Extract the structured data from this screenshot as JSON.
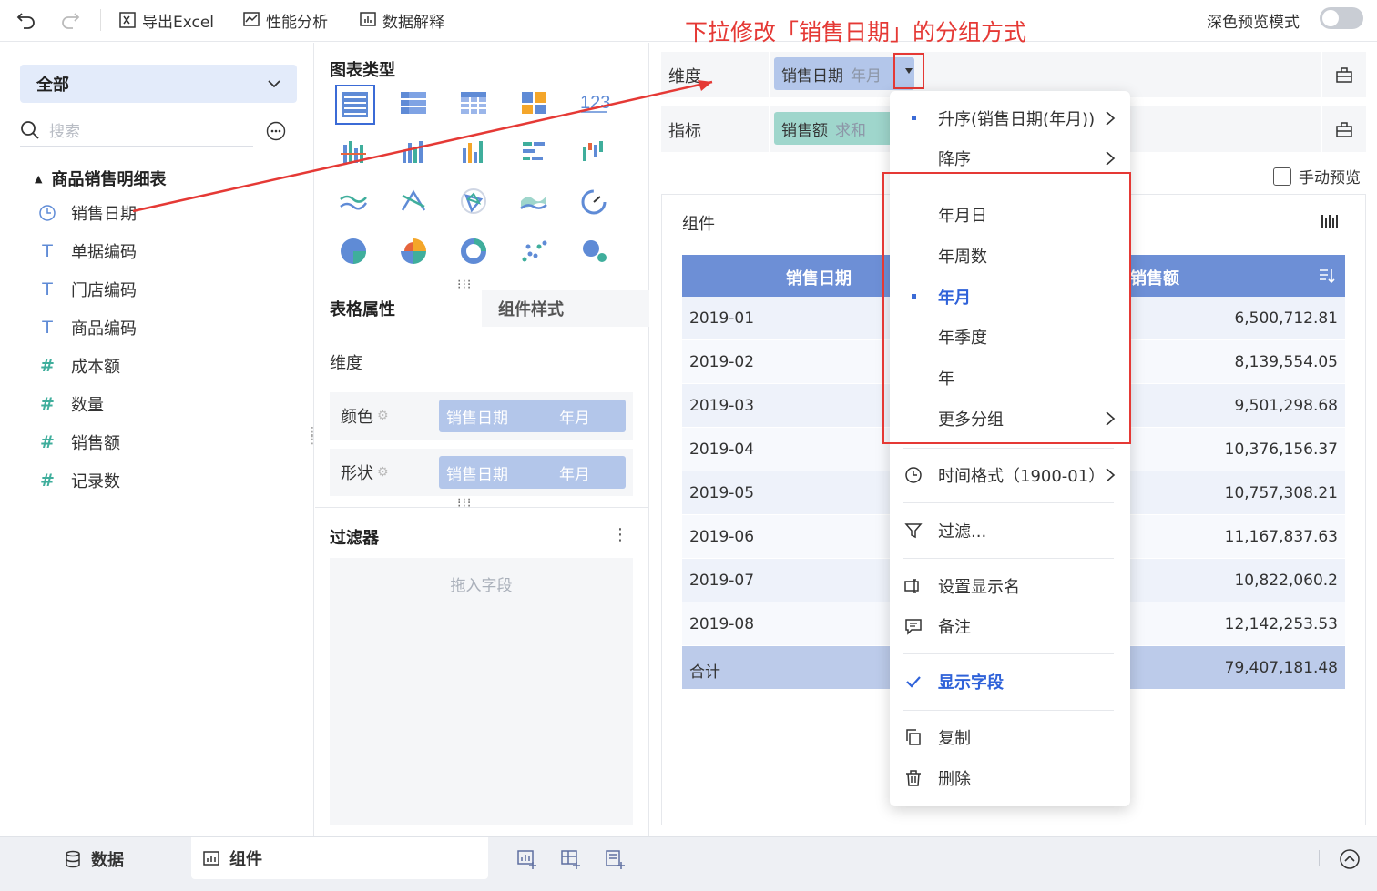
{
  "toolbar": {
    "undo_icon": "undo-icon",
    "redo_icon": "redo-icon",
    "export_label": "导出Excel",
    "perf_label": "性能分析",
    "explain_label": "数据解释",
    "dark_preview_label": "深色预览模式",
    "dark_preview_on": false
  },
  "annotation": "下拉修改「销售日期」的分组方式",
  "left": {
    "scope": "全部",
    "search_placeholder": "搜索",
    "table_name": "商品销售明细表",
    "fields": [
      {
        "icon": "clock-icon",
        "label": "销售日期"
      },
      {
        "icon": "text-icon",
        "label": "单据编码"
      },
      {
        "icon": "text-icon",
        "label": "门店编码"
      },
      {
        "icon": "text-icon",
        "label": "商品编码"
      },
      {
        "icon": "number-icon",
        "label": "成本额"
      },
      {
        "icon": "number-icon",
        "label": "数量"
      },
      {
        "icon": "number-icon",
        "label": "销售额"
      },
      {
        "icon": "number-icon",
        "label": "记录数"
      }
    ]
  },
  "middle": {
    "chart_type_title": "图表类型",
    "tab_table_props": "表格属性",
    "tab_component_style": "组件样式",
    "dimension_label": "维度",
    "color_label": "颜色",
    "color_field": "销售日期",
    "color_group": "年月",
    "shape_label": "形状",
    "shape_field": "销售日期",
    "shape_group": "年月",
    "filter_title": "过滤器",
    "filter_hint": "拖入字段"
  },
  "right": {
    "dimension_label": "维度",
    "dimension_pill": "销售日期",
    "dimension_pill_sub": "年月",
    "measure_label": "指标",
    "measure_pill": "销售额",
    "measure_pill_sub": "求和",
    "manual_preview": "手动预览",
    "component_title": "组件",
    "table": {
      "headers": [
        "销售日期",
        "销售额"
      ],
      "rows": [
        [
          "2019-01",
          "6,500,712.81"
        ],
        [
          "2019-02",
          "8,139,554.05"
        ],
        [
          "2019-03",
          "9,501,298.68"
        ],
        [
          "2019-04",
          "10,376,156.37"
        ],
        [
          "2019-05",
          "10,757,308.21"
        ],
        [
          "2019-06",
          "11,167,837.63"
        ],
        [
          "2019-07",
          "10,822,060.2"
        ],
        [
          "2019-08",
          "12,142,253.53"
        ]
      ],
      "total_label": "合计",
      "total_value": "79,407,181.48"
    }
  },
  "menu": {
    "sort_asc": "升序(销售日期(年月))",
    "sort_desc": "降序",
    "group_ymd": "年月日",
    "group_yw": "年周数",
    "group_ym": "年月",
    "group_yq": "年季度",
    "group_y": "年",
    "more_group": "更多分组",
    "time_format": "时间格式（1900-01）",
    "filter": "过滤...",
    "display_name": "设置显示名",
    "note": "备注",
    "show_field": "显示字段",
    "copy": "复制",
    "delete": "删除"
  },
  "bottom": {
    "data_tab": "数据",
    "component_tab": "组件"
  },
  "colors": {
    "accent": "#2f62d9",
    "highlight_red": "#e53935",
    "table_header": "#6d8fd6"
  }
}
